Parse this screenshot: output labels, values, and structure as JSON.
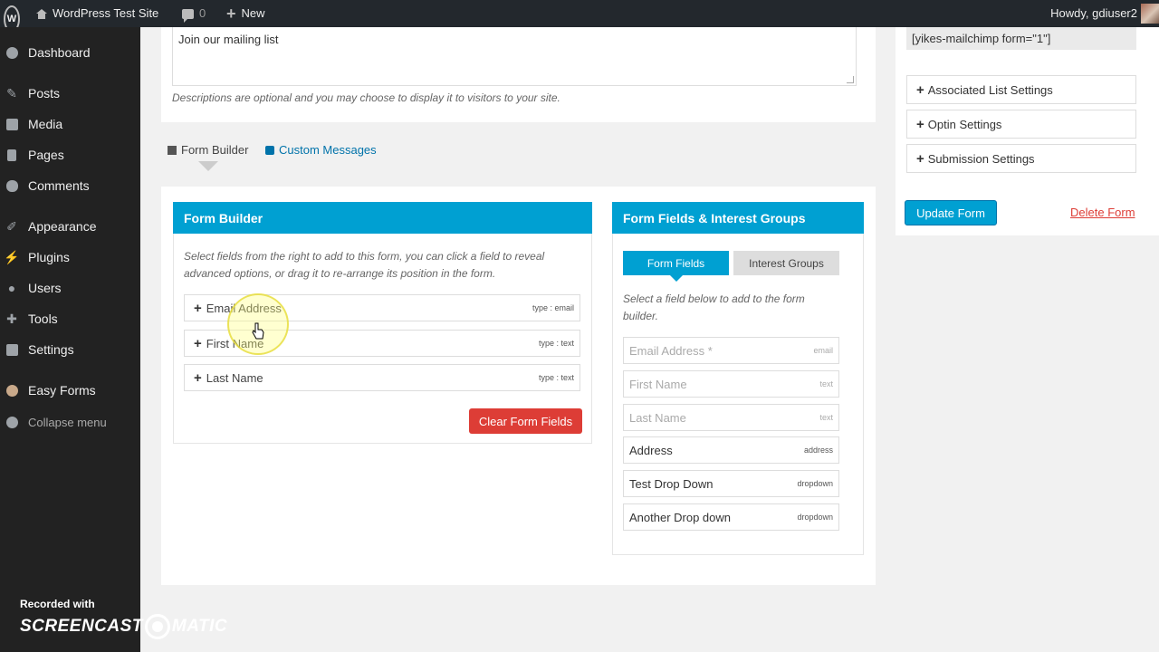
{
  "adminbar": {
    "logo_glyph": "W",
    "site_name": "WordPress Test Site",
    "comments_count": "0",
    "new_label": "New",
    "howdy": "Howdy, gdiuser2"
  },
  "sidebar": {
    "items": [
      {
        "label": "Dashboard",
        "icon": "dashboard-icon"
      },
      {
        "label": "Posts",
        "icon": "pin-icon"
      },
      {
        "label": "Media",
        "icon": "media-icon"
      },
      {
        "label": "Pages",
        "icon": "pages-icon"
      },
      {
        "label": "Comments",
        "icon": "comments-icon"
      },
      {
        "label": "Appearance",
        "icon": "brush-icon"
      },
      {
        "label": "Plugins",
        "icon": "plug-icon"
      },
      {
        "label": "Users",
        "icon": "users-icon"
      },
      {
        "label": "Tools",
        "icon": "wrench-icon"
      },
      {
        "label": "Settings",
        "icon": "settings-icon"
      },
      {
        "label": "Easy Forms",
        "icon": "easy-forms-icon"
      }
    ],
    "collapse_label": "Collapse menu"
  },
  "watermark": {
    "recorded_with": "Recorded with",
    "brand_left": "SCREENCAST",
    "brand_right": "MATIC"
  },
  "description": {
    "value": "Join our mailing list",
    "hint": "Descriptions are optional and you may choose to display it to visitors to your site."
  },
  "tabs": {
    "form_builder": "Form Builder",
    "custom_messages": "Custom Messages"
  },
  "form_builder": {
    "title": "Form Builder",
    "instructions": "Select fields from the right to add to this form, you can click a field to reveal advanced options, or drag it to re-arrange its position in the form.",
    "fields": [
      {
        "label": "Email Address",
        "type": "type : email"
      },
      {
        "label": "First Name",
        "type": "type : text"
      },
      {
        "label": "Last Name",
        "type": "type : text"
      }
    ],
    "clear_button": "Clear Form Fields"
  },
  "fields_panel": {
    "title": "Form Fields & Interest Groups",
    "tab_fields": "Form Fields",
    "tab_groups": "Interest Groups",
    "instructions": "Select a field below to add to the form builder.",
    "available": [
      {
        "label": "Email Address *",
        "type": "email",
        "enabled": false
      },
      {
        "label": "First Name",
        "type": "text",
        "enabled": false
      },
      {
        "label": "Last Name",
        "type": "text",
        "enabled": false
      },
      {
        "label": "Address",
        "type": "address",
        "enabled": true
      },
      {
        "label": "Test Drop Down",
        "type": "dropdown",
        "enabled": true
      },
      {
        "label": "Another Drop down",
        "type": "dropdown",
        "enabled": true
      }
    ]
  },
  "right_sidebar": {
    "shortcode": "[yikes-mailchimp form=\"1\"]",
    "sections": [
      "Associated List Settings",
      "Optin Settings",
      "Submission Settings"
    ],
    "update_button": "Update Form",
    "delete_link": "Delete Form"
  },
  "colors": {
    "accent": "#00a0d2",
    "danger": "#dd3d36",
    "admin_bar": "#23282d",
    "sidebar": "#222222"
  }
}
